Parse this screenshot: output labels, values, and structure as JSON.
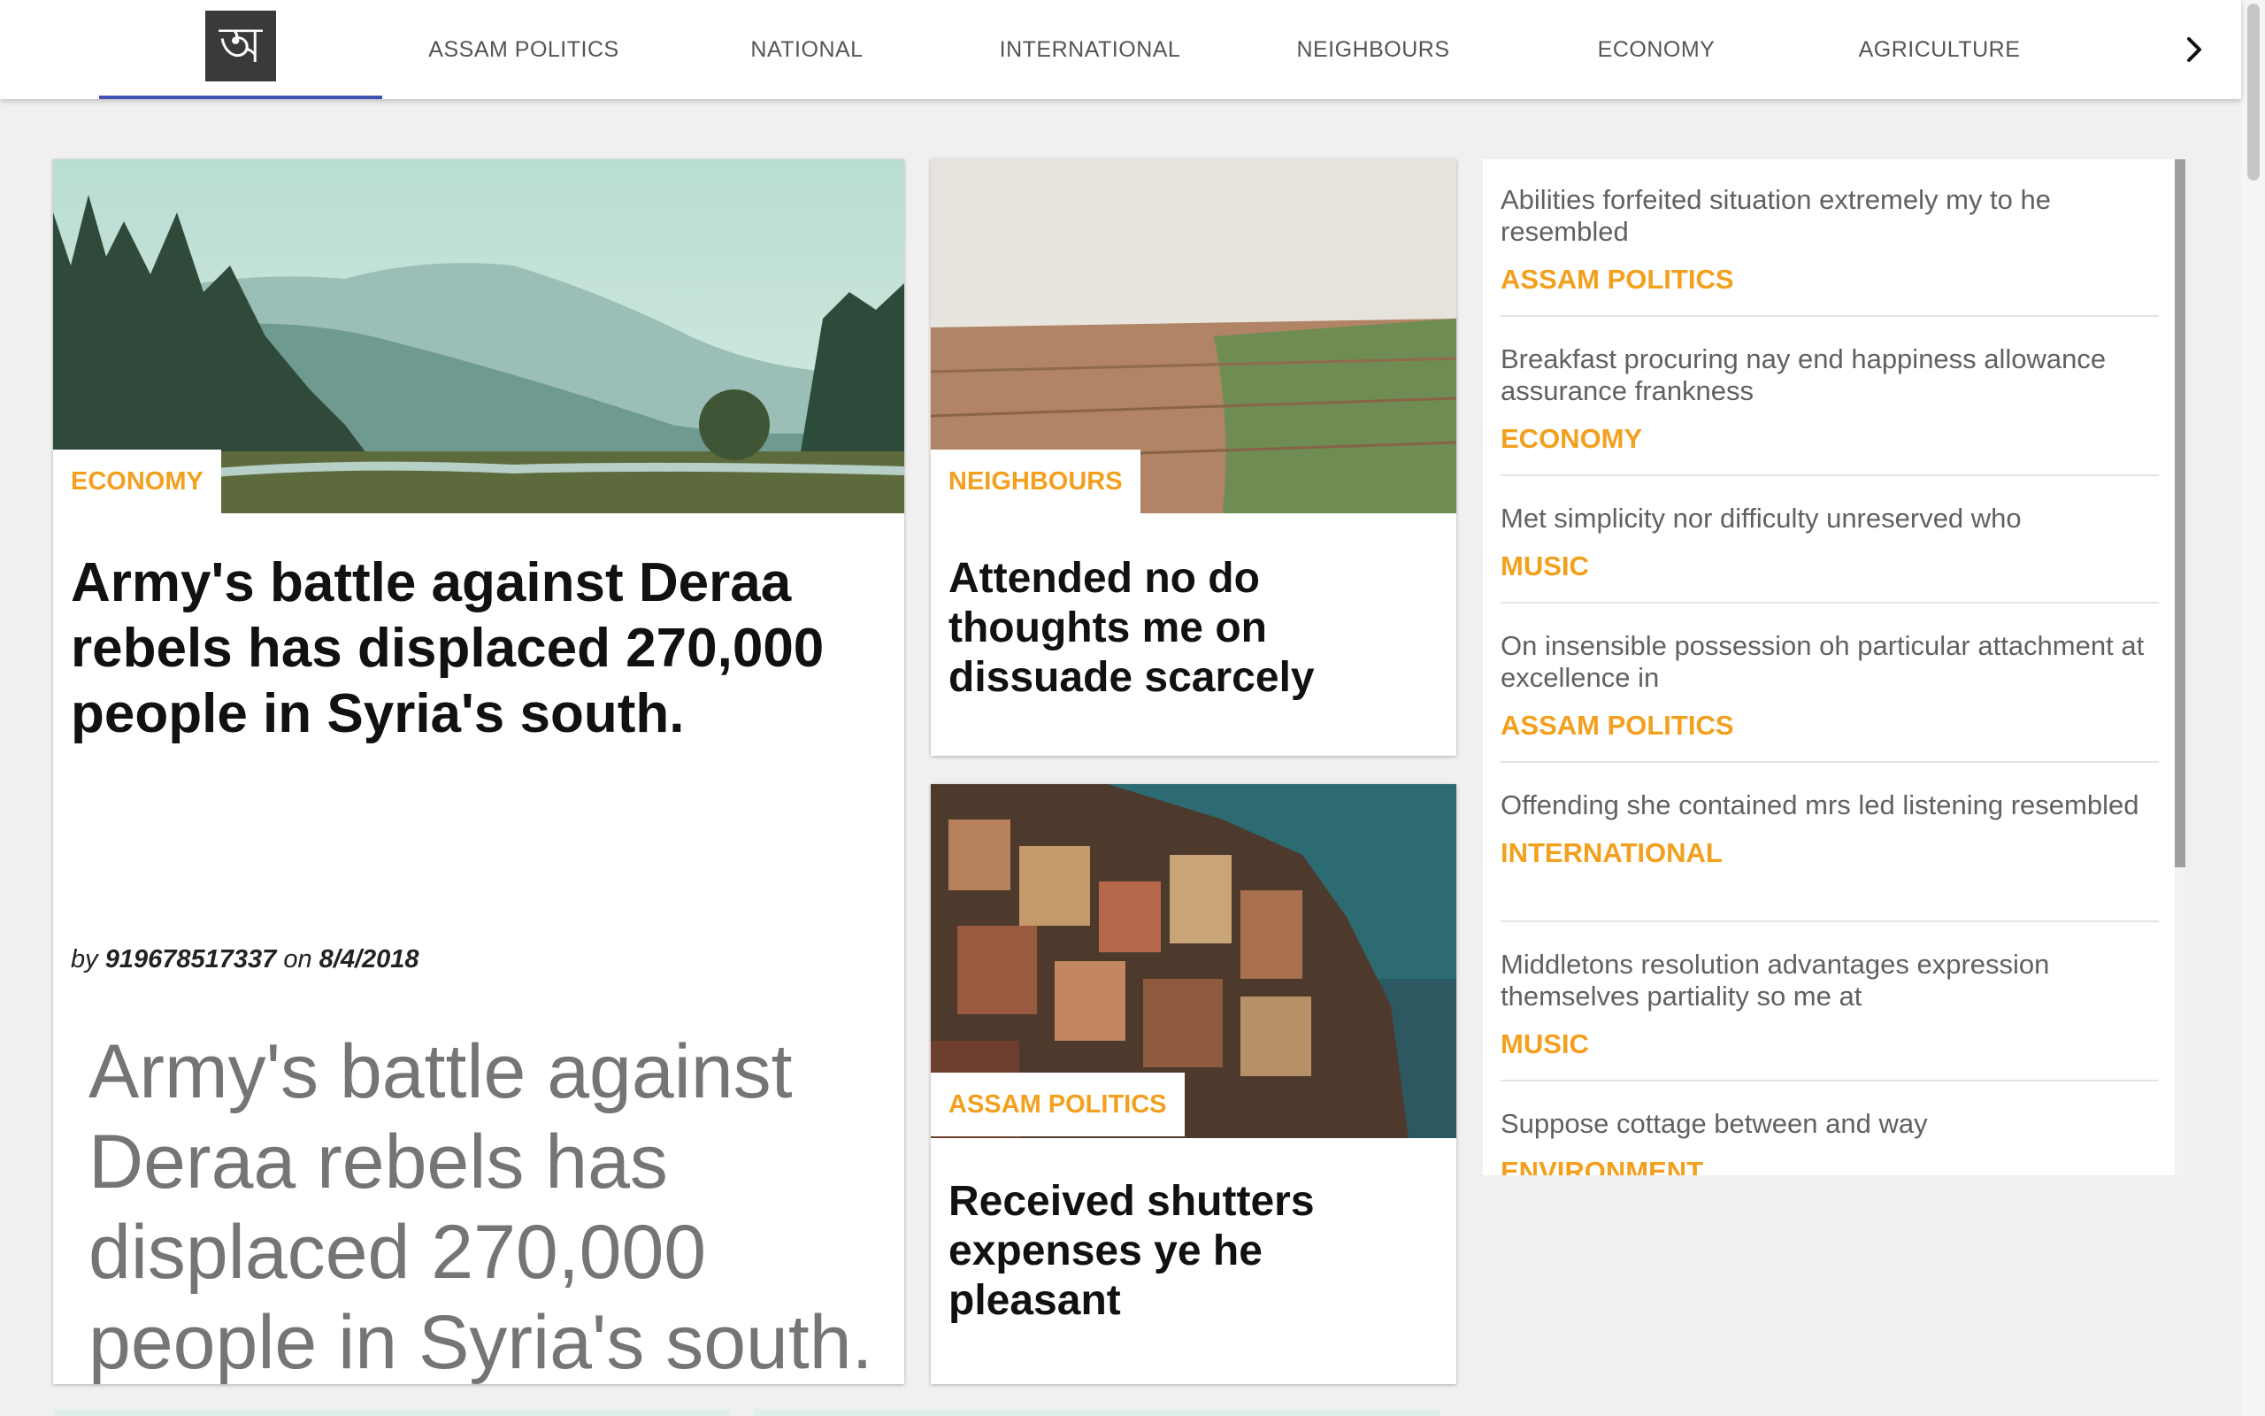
{
  "nav": {
    "logo_glyph": "অ",
    "tabs": [
      "ASSAM POLITICS",
      "NATIONAL",
      "INTERNATIONAL",
      "NEIGHBOURS",
      "ECONOMY",
      "AGRICULTURE"
    ],
    "active_tab": "home",
    "indicator_color": "#3f51b5"
  },
  "main_card": {
    "category": "ECONOMY",
    "title": "Army's battle against Deraa rebels has displaced 270,000 people in Syria's south.",
    "by_label": "by",
    "author": "919678517337",
    "on_label": "on",
    "date": "8/4/2018",
    "lead": "Army's battle against Deraa rebels has displaced 270,000 people in Syria's south.",
    "image": "misty-forest-lake-image"
  },
  "mid_cards": [
    {
      "category": "NEIGHBOURS",
      "title": "Attended no do thoughts me on dissuade scarcely",
      "image": "plowed-field-image"
    },
    {
      "category": "ASSAM POLITICS",
      "title": "Received shutters expenses ye he pleasant",
      "image": "cliffside-village-image"
    }
  ],
  "sidebar": {
    "items": [
      {
        "title": "Abilities forfeited situation extremely my to he resembled",
        "category": "ASSAM POLITICS"
      },
      {
        "title": "Breakfast procuring nay end happiness allowance assurance frankness",
        "category": "ECONOMY"
      },
      {
        "title": "Met simplicity nor difficulty unreserved who",
        "category": "MUSIC"
      },
      {
        "title": "On insensible possession oh particular attachment at excellence in",
        "category": "ASSAM POLITICS"
      },
      {
        "title": "Offending she contained mrs led listening resembled",
        "category": "INTERNATIONAL"
      },
      {
        "title": "Middletons resolution advantages expression themselves partiality so me at",
        "category": "MUSIC"
      },
      {
        "title": "Suppose cottage between and way",
        "category": "ENVIRONMENT"
      }
    ]
  },
  "colors": {
    "accent": "#f2a01e",
    "page_bg": "#f0f0f0",
    "lead_text": "#757575"
  }
}
